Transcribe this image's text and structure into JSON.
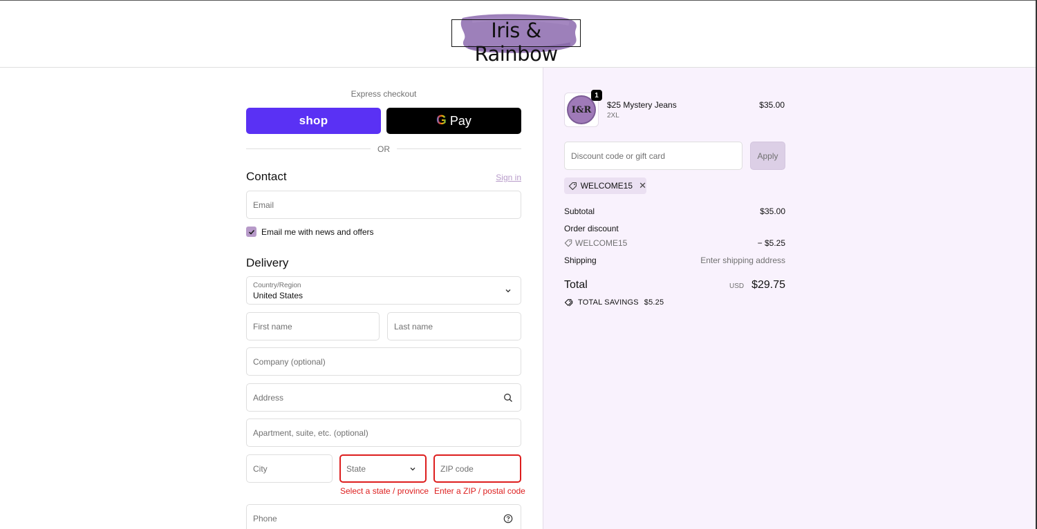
{
  "header": {
    "logo_text": "Iris & Rainbow",
    "brand_color": "#8c6aae"
  },
  "express": {
    "title": "Express checkout",
    "shop_label": "shop",
    "gpay_g": "G",
    "gpay_label": "Pay",
    "or_label": "OR"
  },
  "contact": {
    "title": "Contact",
    "sign_in": "Sign in",
    "email_placeholder": "Email",
    "newsletter_label": "Email me with news and offers",
    "newsletter_checked": true
  },
  "delivery": {
    "title": "Delivery",
    "country_label": "Country/Region",
    "country_value": "United States",
    "first_name": "First name",
    "last_name": "Last name",
    "company": "Company (optional)",
    "address": "Address",
    "apartment": "Apartment, suite, etc. (optional)",
    "city": "City",
    "state": "State",
    "zip": "ZIP code",
    "state_error": "Select a state / province",
    "zip_error": "Enter a ZIP / postal code",
    "phone": "Phone"
  },
  "summary": {
    "product": {
      "thumb_text": "I&R",
      "quantity": "1",
      "name": "$25 Mystery Jeans",
      "variant": "2XL",
      "price": "$35.00"
    },
    "discount_placeholder": "Discount code or gift card",
    "apply_label": "Apply",
    "applied_code": "WELCOME15",
    "subtotal_label": "Subtotal",
    "subtotal_value": "$35.00",
    "order_discount_label": "Order discount",
    "discount_code": "WELCOME15",
    "discount_value": "− $5.25",
    "shipping_label": "Shipping",
    "shipping_value": "Enter shipping address",
    "total_label": "Total",
    "currency": "USD",
    "total_value": "$29.75",
    "savings_label": "TOTAL SAVINGS",
    "savings_value": "$5.25"
  },
  "colors": {
    "shop_pay": "#5a31f4",
    "accent": "#b79ac9",
    "error": "#dd1d1d",
    "summary_bg": "#f9f2fd"
  }
}
